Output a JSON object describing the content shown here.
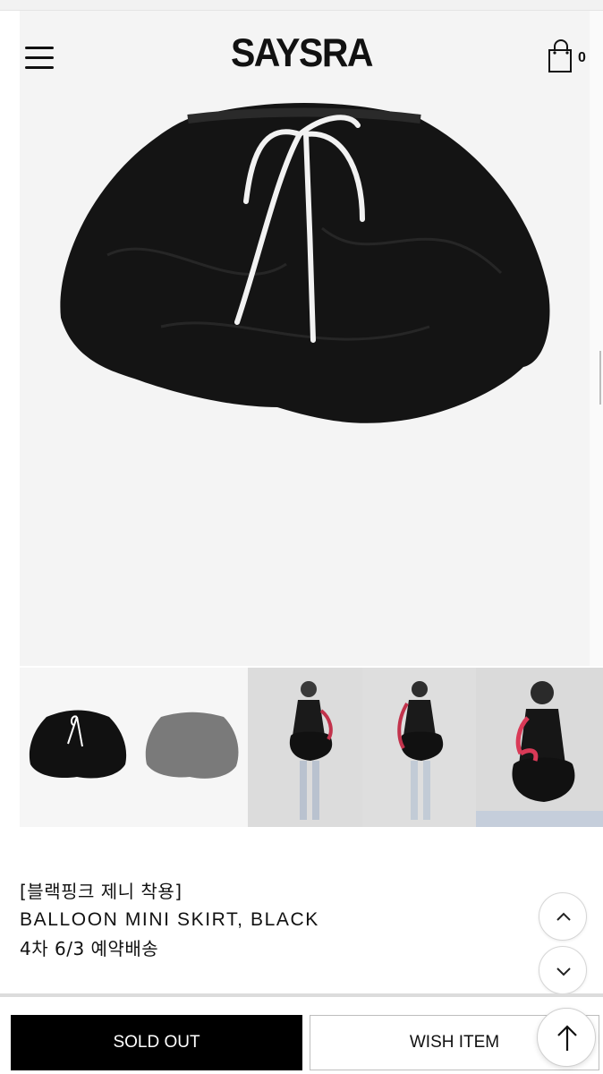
{
  "header": {
    "brand": "SAYSRA",
    "cart_count": "0"
  },
  "gallery": {
    "thumbnails": [
      {
        "name": "skirt-black-flat"
      },
      {
        "name": "skirt-grey-flat"
      },
      {
        "name": "model-front"
      },
      {
        "name": "model-back"
      },
      {
        "name": "model-closeup"
      }
    ]
  },
  "product": {
    "tag_line": "[블랙핑크 제니 착용]",
    "title": "BALLOON MINI SKIRT, BLACK",
    "shipping_note": "4차 6/3 예약배송"
  },
  "actions": {
    "sold_out_label": "SOLD OUT",
    "wish_label": "WISH ITEM"
  },
  "icons": {
    "menu": "hamburger-icon",
    "cart": "shopping-bag-icon",
    "scroll_up": "chevron-up-icon",
    "scroll_down": "chevron-down-icon",
    "back_to_top": "arrow-up-icon"
  }
}
